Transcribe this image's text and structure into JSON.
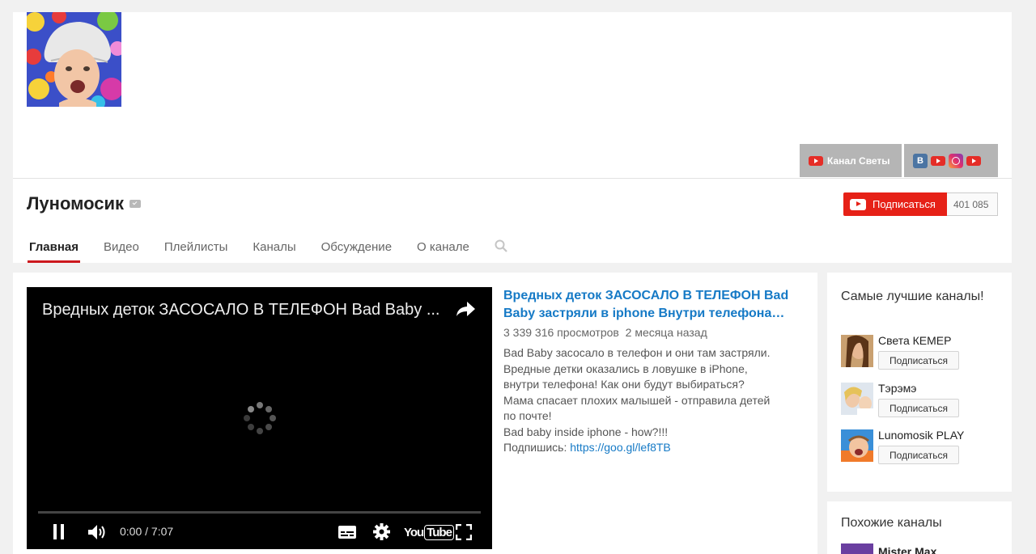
{
  "channel": {
    "name": "Луномосик",
    "banner_links": {
      "channel_label": "Канал Светы",
      "vk_letter": "B"
    },
    "subscribe_label": "Подписаться",
    "subscriber_count": "401 085"
  },
  "tabs": [
    {
      "label": "Главная",
      "active": true
    },
    {
      "label": "Видео"
    },
    {
      "label": "Плейлисты"
    },
    {
      "label": "Каналы"
    },
    {
      "label": "Обсуждение"
    },
    {
      "label": "О канале"
    }
  ],
  "player": {
    "title": "Вредных деток ЗАСОСАЛО В ТЕЛЕФОН Bad Baby ...",
    "time": "0:00 / 7:07",
    "progress": 0,
    "yt_logo_left": "You",
    "yt_logo_right": "Tube"
  },
  "video": {
    "title": "Вредных деток ЗАСОСАЛО В ТЕЛЕФОН Bad Baby застряли в iphone Внутри телефона…",
    "views": "3 339 316 просмотров",
    "age": "2 месяца назад",
    "description_lines": [
      "Bad Baby засосало в телефон и они там застряли.",
      "Вредные детки оказались в ловушке в iPhone,",
      "внутри телефона! Как они будут выбираться?",
      "Мама спасает плохих малышей - отправила детей",
      "по почте!",
      "Bad baby inside iphone - how?!!!"
    ],
    "subscribe_prefix": "Подпишись: ",
    "subscribe_link": "https://goo.gl/lef8TB"
  },
  "sidebar": {
    "best_title": "Самые лучшие каналы!",
    "channels": [
      {
        "name": "Света КЕМЕР",
        "button": "Подписаться"
      },
      {
        "name": "Тэрэмэ",
        "button": "Подписаться"
      },
      {
        "name": "Lunomosik PLAY",
        "button": "Подписаться"
      }
    ],
    "similar_title": "Похожие каналы",
    "similar_first": "Mister Max"
  }
}
